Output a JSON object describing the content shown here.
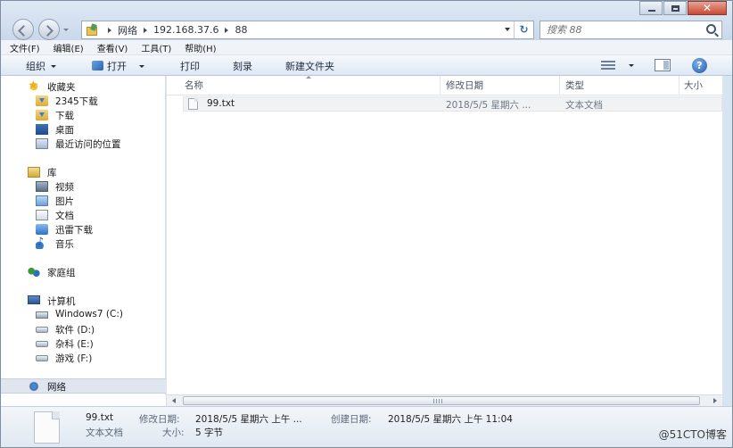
{
  "address": {
    "crumbs": [
      "网络",
      "192.168.37.6",
      "88"
    ]
  },
  "search": {
    "placeholder": "搜索 88"
  },
  "menu": {
    "items": [
      "文件(F)",
      "编辑(E)",
      "查看(V)",
      "工具(T)",
      "帮助(H)"
    ]
  },
  "toolbar": {
    "organize": "组织",
    "open": "打开",
    "print": "打印",
    "burn": "刻录",
    "new_folder": "新建文件夹"
  },
  "sidebar": {
    "favorites": "收藏夹",
    "fav_items": [
      "2345下载",
      "下载",
      "桌面",
      "最近访问的位置"
    ],
    "libraries": "库",
    "lib_items": [
      "视频",
      "图片",
      "文档",
      "迅雷下载",
      "音乐"
    ],
    "homegroup": "家庭组",
    "computer": "计算机",
    "drives": [
      "Windows7 (C:)",
      "软件 (D:)",
      "杂科 (E:)",
      "游戏 (F:)"
    ],
    "network": "网络"
  },
  "columns": {
    "name": "名称",
    "modified": "修改日期",
    "type": "类型",
    "size": "大小"
  },
  "files": [
    {
      "name": "99.txt",
      "modified": "2018/5/5 星期六 ...",
      "type": "文本文档"
    }
  ],
  "details": {
    "filename": "99.txt",
    "filetype": "文本文档",
    "modified_label": "修改日期:",
    "modified_value": "2018/5/5 星期六 上午 ...",
    "created_label": "创建日期:",
    "created_value": "2018/5/5 星期六 上午 11:04",
    "size_label": "大小:",
    "size_value": "5 字节"
  },
  "watermark": "@51CTO博客"
}
